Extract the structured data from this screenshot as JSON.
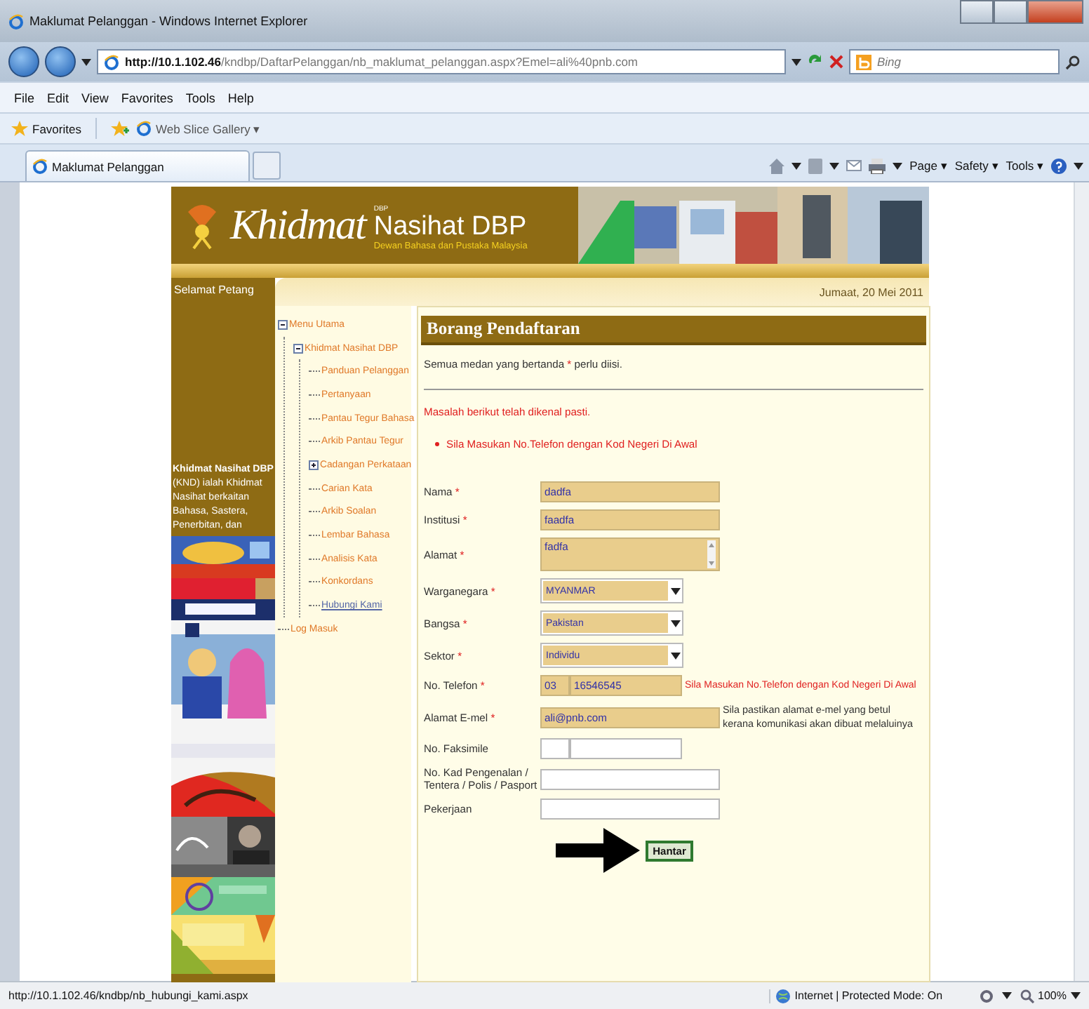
{
  "window": {
    "title": "Maklumat Pelanggan - Windows Internet Explorer"
  },
  "address_bar": {
    "url_host": "http://10.1.102.46",
    "url_path": "/kndbp/DaftarPelanggan/nb_maklumat_pelanggan.aspx?Emel=ali%40pnb.com",
    "search_placeholder": "Bing"
  },
  "menu": [
    "File",
    "Edit",
    "View",
    "Favorites",
    "Tools",
    "Help"
  ],
  "favorites_bar": {
    "favorites": "Favorites",
    "gallery": "Web Slice Gallery ▾"
  },
  "tabs": [
    {
      "label": "Maklumat Pelanggan",
      "selected": true
    }
  ],
  "command_bar": [
    "Page ▾",
    "Safety ▾",
    "Tools ▾"
  ],
  "page": {
    "banner": {
      "script_title": "Khidmat",
      "small_mark": "DBP",
      "title": "Nasihat DBP",
      "subtitle": "Dewan Bahasa dan Pustaka Malaysia"
    },
    "greeting": "Selamat Petang",
    "date": "Jumaat, 20 Mei 2011",
    "sidebar": {
      "about": "**Khidmat Nasihat DBP** (KND) ialah Khidmat Nasihat berkaitan Bahasa, Sastera, Penerbitan, dan"
    },
    "tree": [
      {
        "label": "Menu Utama",
        "selected": false,
        "expanded": true,
        "children": [
          {
            "label": "Khidmat Nasihat DBP",
            "selected": false,
            "expanded": true,
            "children": [
              {
                "label": "Panduan Pelanggan",
                "selected": false
              },
              {
                "label": "Pertanyaan",
                "selected": false
              },
              {
                "label": "Pantau Tegur Bahasa",
                "selected": false
              },
              {
                "label": "Arkib Pantau Tegur",
                "selected": false
              },
              {
                "label": "Cadangan Perkataan",
                "selected": false,
                "expanded": false
              },
              {
                "label": "Carian Kata",
                "selected": false
              },
              {
                "label": "Arkib Soalan",
                "selected": false
              },
              {
                "label": "Lembar Bahasa",
                "selected": false
              },
              {
                "label": "Analisis Kata",
                "selected": false
              },
              {
                "label": "Konkordans",
                "selected": false
              },
              {
                "label": "Hubungi Kami",
                "selected": true
              }
            ]
          }
        ]
      },
      {
        "label": "Log Masuk",
        "selected": false
      }
    ],
    "form": {
      "title": "Borang Pendaftaran",
      "required_mark": "*",
      "note": [
        "Semua medan yang bertanda ",
        "*",
        " perlu diisi."
      ],
      "error_heading": "Masalah berikut telah dikenal pasti.",
      "errors": [
        "Sila Masukan No.Telefon dengan Kod Negeri Di Awal"
      ],
      "fields": [
        {
          "label": "Nama",
          "required": true,
          "kind": "text",
          "value": "dadfa"
        },
        {
          "label": "Institusi",
          "required": true,
          "kind": "text",
          "value": "faadfa"
        },
        {
          "label": "Alamat",
          "required": true,
          "kind": "textarea",
          "value": "fadfa"
        },
        {
          "label": "Warganegara",
          "required": true,
          "kind": "select",
          "value": "MYANMAR"
        },
        {
          "label": "Bangsa",
          "required": true,
          "kind": "select",
          "value": "Pakistan"
        },
        {
          "label": "Sektor",
          "required": true,
          "kind": "select",
          "value": "Individu"
        },
        {
          "label": "No. Telefon",
          "required": true,
          "kind": "phone",
          "code": "03",
          "value": "16546545",
          "error": "Sila Masukan No.Telefon dengan Kod Negeri Di Awal"
        },
        {
          "label": "Alamat E-mel",
          "required": true,
          "kind": "email",
          "value": "ali@pnb.com",
          "note": "Sila pastikan alamat e-mel yang betul kerana komunikasi akan dibuat melaluinya"
        },
        {
          "label": "No. Faksimile",
          "required": false,
          "kind": "phone"
        },
        {
          "label": "No. Kad Pengenalan / Tentera / Polis / Pasport",
          "required": false,
          "kind": "text"
        },
        {
          "label": "Pekerjaan",
          "required": false,
          "kind": "text"
        }
      ],
      "submit": "Hantar"
    }
  },
  "status_bar": {
    "url": "http://10.1.102.46/kndbp/nb_hubungi_kami.aspx",
    "zone": "Internet | Protected Mode: On",
    "zoom": "100%"
  }
}
